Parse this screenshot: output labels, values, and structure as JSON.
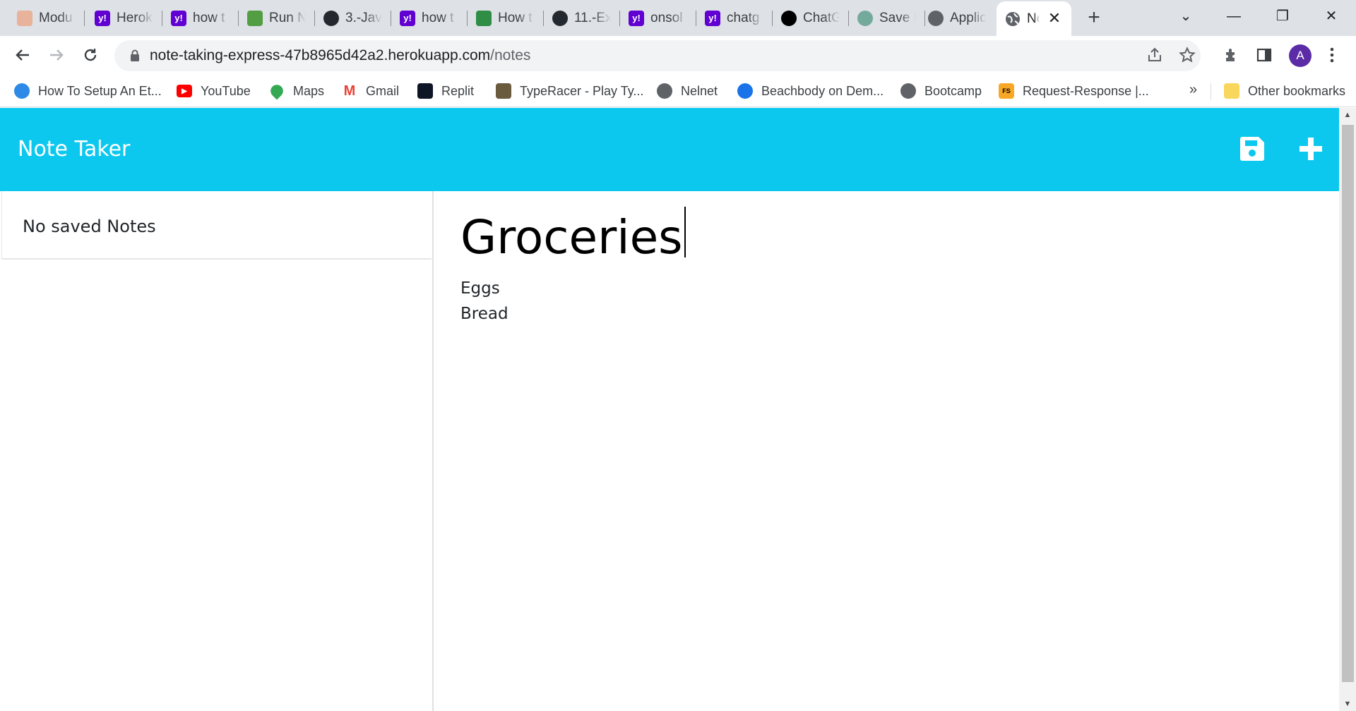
{
  "browser": {
    "tabs": [
      {
        "title": "Modu",
        "icon": "module-icon",
        "color": "#e8b39a"
      },
      {
        "title": "Herok",
        "icon": "yahoo-icon",
        "color": "#6001d2"
      },
      {
        "title": "how t",
        "icon": "yahoo-icon",
        "color": "#6001d2"
      },
      {
        "title": "Run N",
        "icon": "nodejs-icon",
        "color": "#539e43"
      },
      {
        "title": "3.-Jav",
        "icon": "github-icon",
        "color": "#24292f"
      },
      {
        "title": "how t",
        "icon": "yahoo-icon",
        "color": "#6001d2"
      },
      {
        "title": "How t",
        "icon": "geeksforgeeks-icon",
        "color": "#2f8d46"
      },
      {
        "title": "11.-Ex",
        "icon": "github-icon",
        "color": "#24292f"
      },
      {
        "title": "onsol",
        "icon": "yahoo-icon",
        "color": "#6001d2"
      },
      {
        "title": "chatg",
        "icon": "yahoo-icon",
        "color": "#6001d2"
      },
      {
        "title": "ChatG",
        "icon": "openai-icon",
        "color": "#000000"
      },
      {
        "title": "Save I",
        "icon": "chatgpt-icon",
        "color": "#74aa9c"
      },
      {
        "title": "Applic",
        "icon": "globe-icon",
        "color": "#5f6368"
      }
    ],
    "active_tab": {
      "title": "Note",
      "icon": "globe-icon",
      "close": "✕"
    },
    "new_tab": "+",
    "window_controls": {
      "dropdown": "⌄",
      "minimize": "—",
      "restore": "❐",
      "close": "✕"
    },
    "url_host": "note-taking-express-47b8965d42a2.herokuapp.com",
    "url_path": "/notes",
    "avatar": "A",
    "bookmarks": [
      {
        "label": "How To Setup An Et...",
        "icon": "ethereum-icon",
        "color": "#2e8ae6"
      },
      {
        "label": "YouTube",
        "icon": "youtube-icon",
        "color": "#ff0000"
      },
      {
        "label": "Maps",
        "icon": "maps-icon",
        "color": "#34a853"
      },
      {
        "label": "Gmail",
        "icon": "gmail-icon",
        "color": "#ea4335"
      },
      {
        "label": "Replit",
        "icon": "replit-icon",
        "color": "#0e1525"
      },
      {
        "label": "TypeRacer - Play Ty...",
        "icon": "typeracer-icon",
        "color": "#6b5b3e"
      },
      {
        "label": "Nelnet",
        "icon": "globe-icon",
        "color": "#5f6368"
      },
      {
        "label": "Beachbody on Dem...",
        "icon": "beachbody-icon",
        "color": "#1a73e8"
      },
      {
        "label": "Bootcamp",
        "icon": "globe-icon",
        "color": "#5f6368"
      },
      {
        "label": "Request-Response |...",
        "icon": "fs-icon",
        "color": "#f9a825"
      }
    ],
    "bookmarks_overflow": "»",
    "other_bookmarks": "Other bookmarks"
  },
  "app": {
    "title": "Note Taker",
    "accent_color": "#0dc8ee",
    "sidebar_empty": "No saved Notes",
    "note_title": "Groceries",
    "note_text": "Eggs\nBread"
  }
}
